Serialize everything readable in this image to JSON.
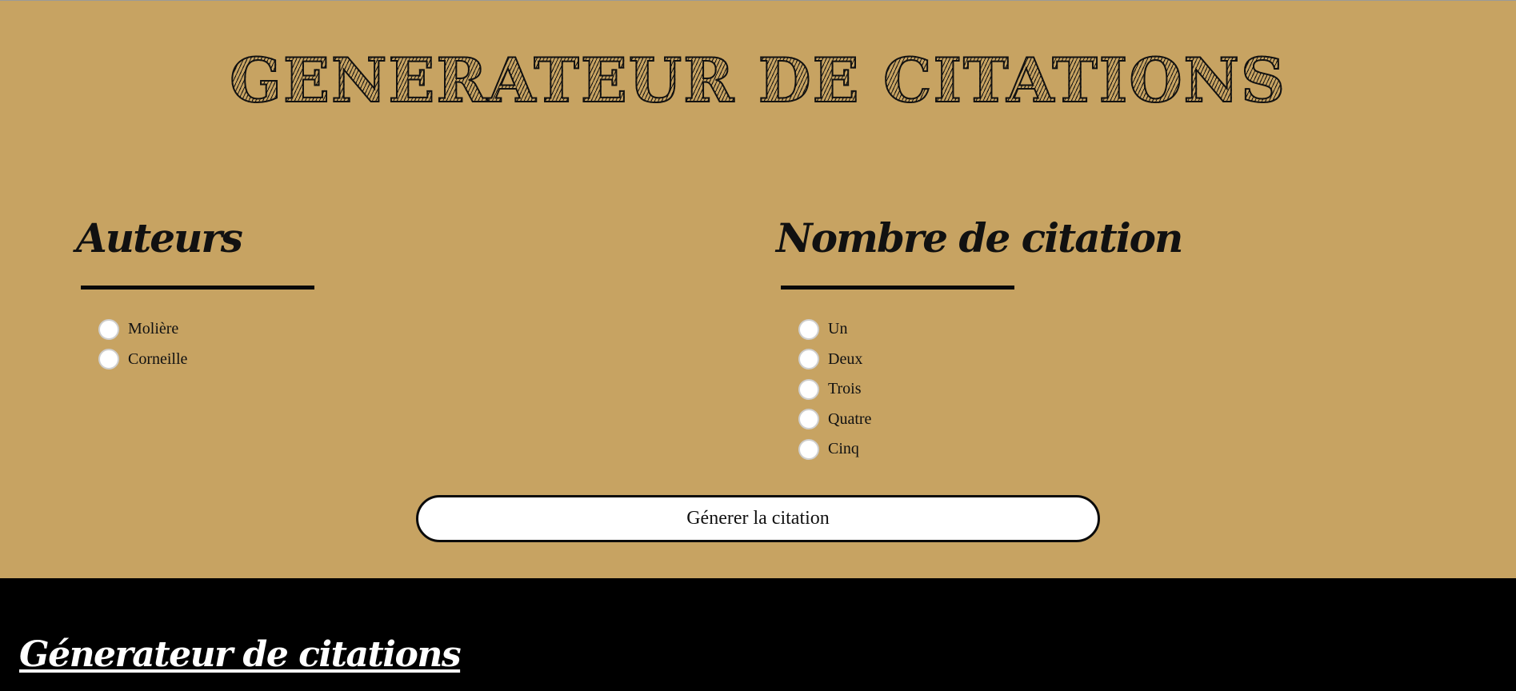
{
  "header": {
    "title": "GENERATEUR DE CITATIONS"
  },
  "authors": {
    "heading": "Auteurs",
    "options": [
      "Molière",
      "Corneille"
    ]
  },
  "count": {
    "heading": "Nombre de citation",
    "options": [
      "Un",
      "Deux",
      "Trois",
      "Quatre",
      "Cinq"
    ]
  },
  "actions": {
    "generate_label": "Génerer la citation"
  },
  "footer": {
    "title": "Génerateur de citations"
  },
  "colors": {
    "background": "#c7a362",
    "footer": "#000000",
    "button": "#ffffff"
  },
  "icons": {
    "radio": "radio-unchecked-icon"
  }
}
